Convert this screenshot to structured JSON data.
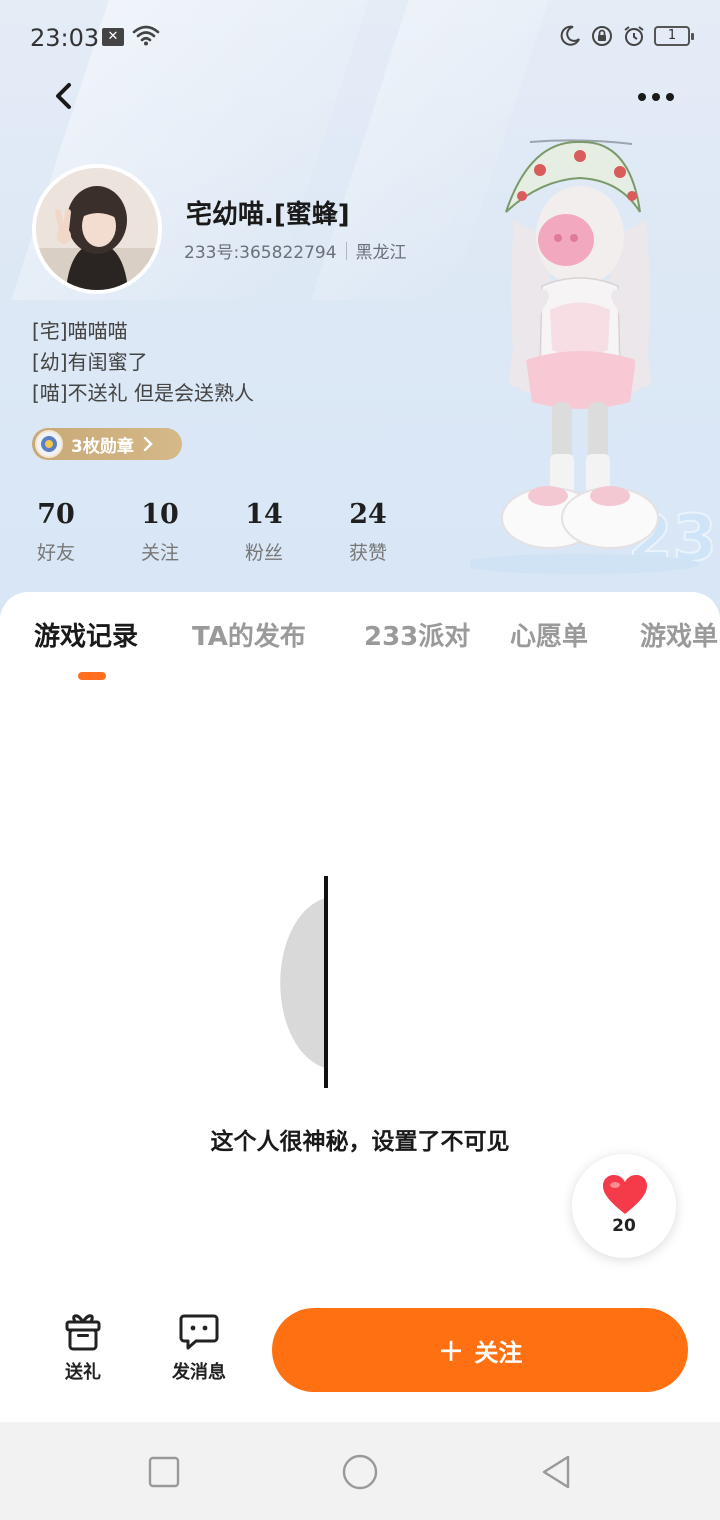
{
  "status_bar": {
    "time": "23:03",
    "notification_icon": "x-box-icon",
    "battery_level": "1"
  },
  "nav": {
    "back_icon": "chevron-left-icon",
    "more_icon": "more-dots-icon"
  },
  "profile": {
    "nickname": "宅幼喵.[蜜蜂]",
    "id_text": "233号:365822794",
    "location": "黑龙江",
    "bio": [
      "[宅]喵喵喵",
      "[幼]有闺蜜了",
      "[喵]不送礼 但是会送熟人"
    ],
    "badge_text": "3枚勋章"
  },
  "stats": [
    {
      "value": "70",
      "label": "好友"
    },
    {
      "value": "10",
      "label": "关注"
    },
    {
      "value": "14",
      "label": "粉丝"
    },
    {
      "value": "24",
      "label": "获赞"
    }
  ],
  "tabs": [
    "游戏记录",
    "TA的发布",
    "233派对",
    "心愿单",
    "游戏单"
  ],
  "active_tab": 0,
  "empty_state": {
    "message": "这个人很神秘，设置了不可见"
  },
  "like_bubble": {
    "count": "20"
  },
  "actions": {
    "gift_label": "送礼",
    "message_label": "发消息",
    "follow_label": "关注"
  },
  "colors": {
    "accent": "#ff7012",
    "badge_gold": "#c8a877",
    "header_bg": "#dde8f5"
  }
}
